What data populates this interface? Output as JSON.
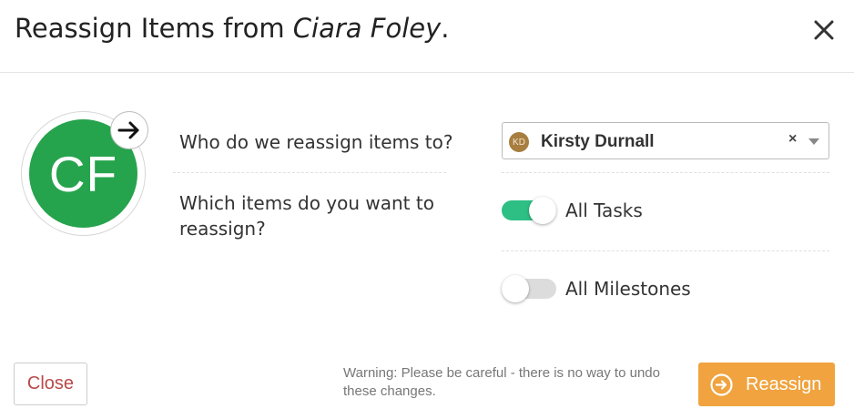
{
  "header": {
    "title_prefix": "Reassign Items from ",
    "title_name": "Ciara Foley",
    "title_suffix": ".",
    "close_icon": "close-icon"
  },
  "from_user": {
    "initials": "CF",
    "avatar_color": "#26a34d",
    "badge_icon": "arrow-right-icon"
  },
  "questions": {
    "who": "Who do we reassign items to?",
    "which": "Which items do you want to reassign?"
  },
  "assignee_select": {
    "initials": "KD",
    "avatar_color": "#a77e3f",
    "value": "Kirsty Durnall",
    "clear_label": "×"
  },
  "toggles": [
    {
      "label": "All Tasks",
      "on": true
    },
    {
      "label": "All Milestones",
      "on": false
    }
  ],
  "toggle_on_color": "#2dbf84",
  "footer": {
    "close_label": "Close",
    "warning": "Warning: Please be careful - there is no way to undo these changes.",
    "reassign_label": "Reassign",
    "reassign_color": "#f0a33e",
    "reassign_icon": "arrow-circle-right-icon"
  }
}
